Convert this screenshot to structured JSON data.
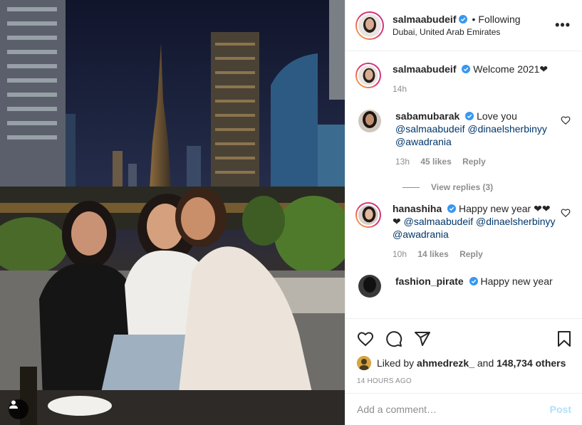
{
  "header": {
    "username": "salmaabudeif",
    "separator": "•",
    "follow_status": "Following",
    "location": "Dubai, United Arab Emirates",
    "more_label": "•••"
  },
  "caption": {
    "username": "salmaabudeif",
    "text": "Welcome 2021❤",
    "age": "14h"
  },
  "comments": [
    {
      "username": "sabamubarak",
      "text": "Love you",
      "mentions": "@salmaabudeif @dinaelsherbinyy @awadrania",
      "age": "13h",
      "likes": "45 likes",
      "reply": "Reply",
      "view_replies": "View replies (3)"
    },
    {
      "username": "hanashiha",
      "text": "Happy new year ❤❤❤",
      "mentions": "@salmaabudeif @dinaelsherbinyy @awadrania",
      "age": "10h",
      "likes": "14 likes",
      "reply": "Reply"
    },
    {
      "username": "fashion_pirate",
      "text": "Happy new year"
    }
  ],
  "likes": {
    "prefix": "Liked by",
    "user": "ahmedrezk_",
    "mid": "and",
    "others": "148,734 others"
  },
  "timestamp": "14 hours ago",
  "add_comment": {
    "placeholder": "Add a comment…",
    "post_label": "Post"
  },
  "icons": {
    "like": "heart-icon",
    "comment": "comment-icon",
    "share": "share-icon",
    "save": "bookmark-icon",
    "tag": "user-tag-icon"
  },
  "colors": {
    "verified": "#3897f0",
    "mention": "#00376b",
    "muted": "#8e8e8e",
    "post_disabled": "#b2dffc"
  }
}
